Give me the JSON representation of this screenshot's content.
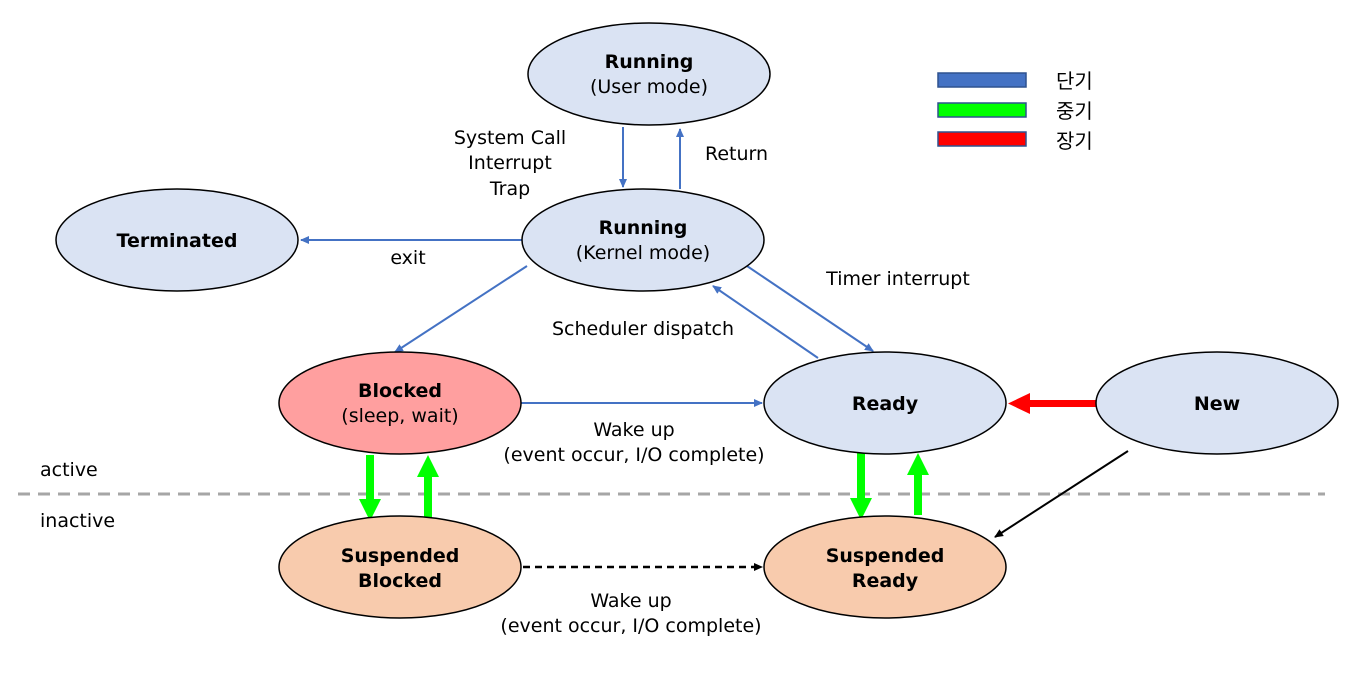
{
  "legend": [
    {
      "label": "단기",
      "color": "#4472c4"
    },
    {
      "label": "중기",
      "color": "#00ff00"
    },
    {
      "label": "장기",
      "color": "#ff0000"
    }
  ],
  "zones": {
    "active": "active",
    "inactive": "inactive"
  },
  "nodes": {
    "running_user": {
      "title": "Running",
      "sub": "(User mode)",
      "fill": "#dae3f3"
    },
    "running_kernel": {
      "title": "Running",
      "sub": "(Kernel mode)",
      "fill": "#dae3f3"
    },
    "terminated": {
      "title": "Terminated",
      "fill": "#dae3f3"
    },
    "blocked": {
      "title": "Blocked",
      "sub": "(sleep, wait)",
      "fill": "#ff9f9f"
    },
    "ready": {
      "title": "Ready",
      "fill": "#dae3f3"
    },
    "new": {
      "title": "New",
      "fill": "#dae3f3"
    },
    "suspended_blocked": {
      "title": "Suspended",
      "sub": "Blocked",
      "fill": "#f8cbad"
    },
    "suspended_ready": {
      "title": "Suspended",
      "sub": "Ready",
      "fill": "#f8cbad"
    }
  },
  "edge_labels": {
    "syscall_1": "System Call",
    "syscall_2": "Interrupt",
    "syscall_3": "Trap",
    "return": "Return",
    "exit": "exit",
    "timer": "Timer interrupt",
    "dispatch": "Scheduler dispatch",
    "wake1_1": "Wake up",
    "wake1_2": "(event occur, I/O complete)",
    "wake2_1": "Wake up",
    "wake2_2": "(event occur, I/O complete)"
  }
}
